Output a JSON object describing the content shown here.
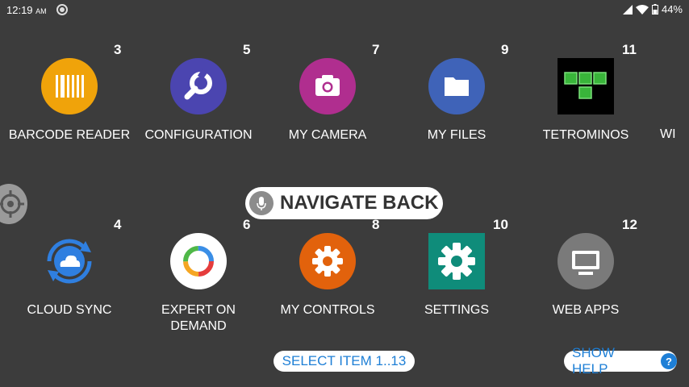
{
  "status": {
    "time": "12:19",
    "ampm": "AM",
    "battery": "44%"
  },
  "tiles": [
    {
      "num": "3",
      "label": "BARCODE READER",
      "icon": "barcode-icon",
      "color": "#f0a30a"
    },
    {
      "num": "5",
      "label": "CONFIGURATION",
      "icon": "wrench-icon",
      "color": "#4b45b0"
    },
    {
      "num": "7",
      "label": "MY CAMERA",
      "icon": "camera-icon",
      "color": "#b02e8f"
    },
    {
      "num": "9",
      "label": "MY FILES",
      "icon": "folder-icon",
      "color": "#3f63b8"
    },
    {
      "num": "11",
      "label": "TETROMINOS",
      "icon": "tetromino-icon",
      "color": "#000000"
    },
    {
      "num": "4",
      "label": "CLOUD SYNC",
      "icon": "cloud-sync-icon",
      "color": "#2f7fe0"
    },
    {
      "num": "6",
      "label_line1": "EXPERT ON",
      "label_line2": "DEMAND",
      "icon": "expert-icon",
      "color": "#ffffff"
    },
    {
      "num": "8",
      "label": "MY CONTROLS",
      "icon": "gear-icon",
      "color": "#e2620c"
    },
    {
      "num": "10",
      "label": "SETTINGS",
      "icon": "settings-gear-icon",
      "color": "#0f8c7a"
    },
    {
      "num": "12",
      "label": "WEB APPS",
      "icon": "monitor-icon",
      "color": "#7a7a7a"
    }
  ],
  "partial_label": "WI",
  "navigate_back": "NAVIGATE BACK",
  "select_item": "SELECT ITEM 1..13",
  "show_help": "SHOW HELP",
  "help_glyph": "?"
}
